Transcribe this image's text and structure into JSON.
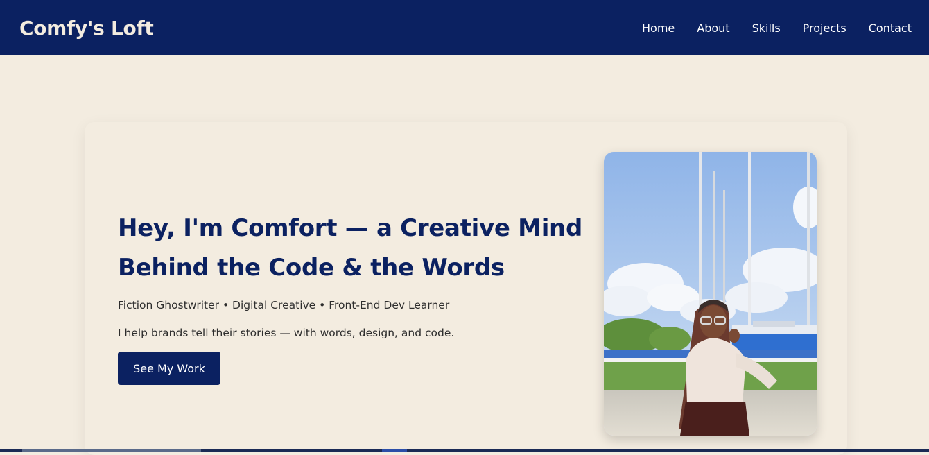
{
  "brand": "Comfy's Loft",
  "nav": {
    "items": [
      "Home",
      "About",
      "Skills",
      "Projects",
      "Contact"
    ]
  },
  "hero": {
    "title_line1": "Hey, I'm Comfort — a Creative Mind",
    "title_line2": "Behind the Code & the Words",
    "tagline": "Fiction Ghostwriter • Digital Creative • Front-End Dev Learner",
    "description": "I help brands tell their stories — with words, design, and code.",
    "cta_label": "See My Work"
  },
  "colors": {
    "navy": "#0b2161",
    "cream": "#f3ece0",
    "body_text": "#2d2d2d"
  }
}
